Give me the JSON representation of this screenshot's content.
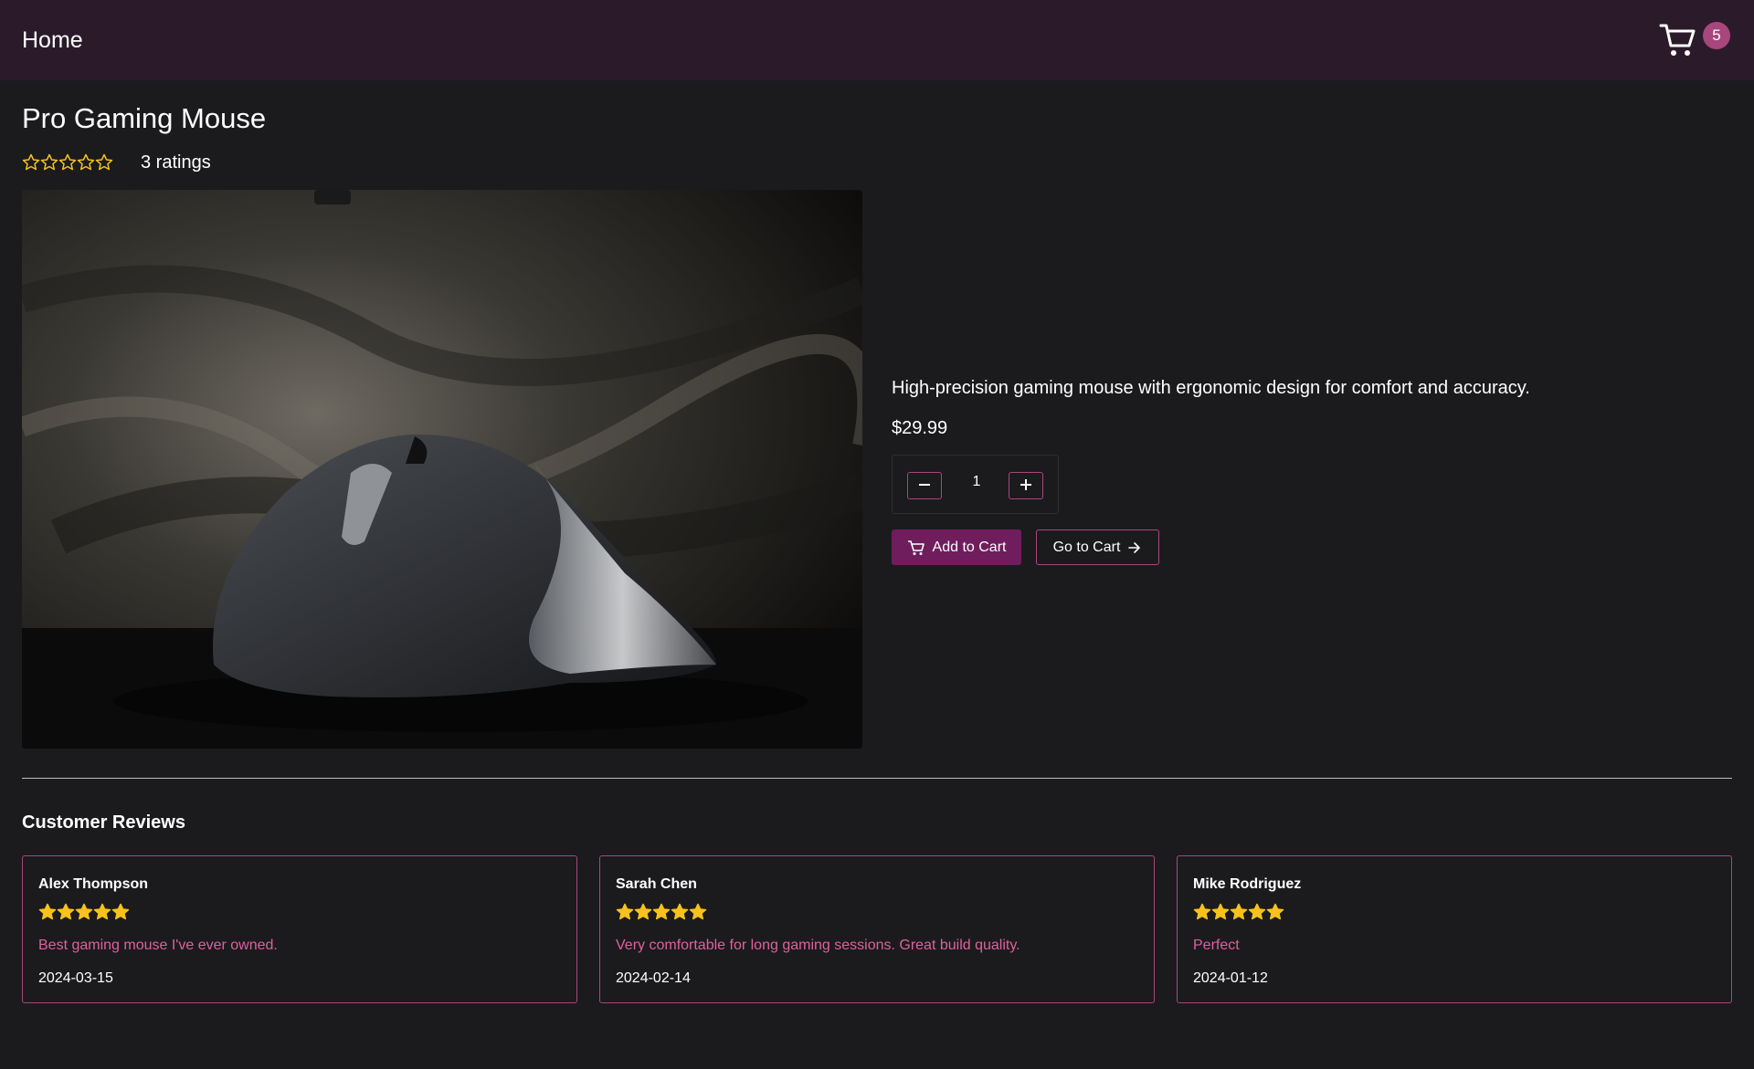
{
  "nav": {
    "home_label": "Home",
    "cart_count": "5"
  },
  "product": {
    "name": "Pro Gaming Mouse",
    "rating_stars": 0,
    "ratings_label": "3 ratings",
    "description": "High-precision gaming mouse with ergonomic design for comfort and accuracy.",
    "price": "$29.99",
    "quantity": "1",
    "add_to_cart_label": "Add to Cart",
    "go_to_cart_label": "Go to Cart"
  },
  "reviews": {
    "heading": "Customer Reviews",
    "items": [
      {
        "name": "Alex Thompson",
        "stars": 5,
        "text": "Best gaming mouse I've ever owned.",
        "date": "2024-03-15"
      },
      {
        "name": "Sarah Chen",
        "stars": 5,
        "text": "Very comfortable for long gaming sessions. Great build quality.",
        "date": "2024-02-14"
      },
      {
        "name": "Mike Rodriguez",
        "stars": 5,
        "text": "Perfect",
        "date": "2024-01-12"
      }
    ]
  },
  "colors": {
    "accent": "#a8467d",
    "button_primary": "#6f1d5d",
    "navbar": "#2b1b2a",
    "background": "#1b1b1e",
    "star": "#f6c21b",
    "review_text": "#e0609e"
  },
  "icons": {
    "cart": "cart-icon",
    "star": "star-icon",
    "minus": "minus-icon",
    "plus": "plus-icon",
    "arrow": "arrow-right-icon"
  }
}
